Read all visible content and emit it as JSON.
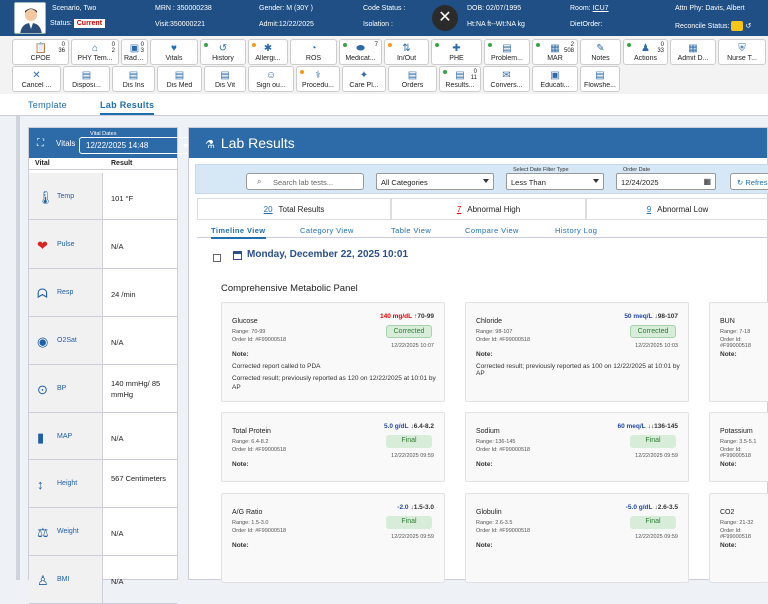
{
  "header": {
    "scenario_label": "Scenario, Two",
    "status_label": "Status:",
    "status_value": "Current",
    "mrn": "MRN : 350000238",
    "visit": "Visit:350000221",
    "gender": "Gender: M (30Y )",
    "admit": "Admit:12/22/2025",
    "code_status": "Code Status :",
    "isolation": "Isolation :",
    "dob": "DOB: 02/07/1995",
    "ht_wt": "Ht:NA ft--Wt:NA kg",
    "room_label": "Room:",
    "room_value": "ICU7",
    "diet": "DietOrder:",
    "attn": "Attn Phy: Davis, Albert",
    "reconcile": "Reconcile Status:"
  },
  "toolbar": [
    {
      "label": "CPOE",
      "icon": "clipboard-icon",
      "dot": "",
      "cnt": "0\n36"
    },
    {
      "label": "PHY Tem...",
      "icon": "home-icon",
      "dot": "",
      "cnt": "0\n2"
    },
    {
      "label": "Radiolo...",
      "icon": "radiology-icon",
      "dot": "",
      "cnt": "0\n3"
    },
    {
      "label": "Vitals",
      "icon": "heart-icon",
      "dot": "",
      "cnt": ""
    },
    {
      "label": "History",
      "icon": "history-icon",
      "dot": "g",
      "cnt": ""
    },
    {
      "label": "Allergi...",
      "icon": "allergy-icon",
      "dot": "o",
      "cnt": ""
    },
    {
      "label": "ROS",
      "icon": "ros-icon",
      "dot": "",
      "cnt": ""
    },
    {
      "label": "Medicat...",
      "icon": "pill-icon",
      "dot": "g",
      "cnt": "7"
    },
    {
      "label": "In/Out",
      "icon": "inout-icon",
      "dot": "o",
      "cnt": ""
    },
    {
      "label": "PHE",
      "icon": "phe-icon",
      "dot": "g",
      "cnt": ""
    },
    {
      "label": "Problem...",
      "icon": "problem-icon",
      "dot": "g",
      "cnt": ""
    },
    {
      "label": "MAR",
      "icon": "mar-icon",
      "dot": "g",
      "cnt": "2\n508"
    },
    {
      "label": "Notes",
      "icon": "notes-icon",
      "dot": "",
      "cnt": ""
    },
    {
      "label": "Actions",
      "icon": "actions-icon",
      "dot": "g",
      "cnt": "0\n33"
    },
    {
      "label": "Admit D...",
      "icon": "admit-icon",
      "dot": "",
      "cnt": ""
    },
    {
      "label": "Nurse T...",
      "icon": "nurse-icon",
      "dot": "",
      "cnt": ""
    },
    {
      "label": "Cancel ...",
      "icon": "cancel-icon",
      "dot": "",
      "cnt": ""
    },
    {
      "label": "Disposi...",
      "icon": "dispo-icon",
      "dot": "",
      "cnt": ""
    },
    {
      "label": "Dis Ins",
      "icon": "disins-icon",
      "dot": "",
      "cnt": ""
    },
    {
      "label": "Dis Med",
      "icon": "dismed-icon",
      "dot": "",
      "cnt": ""
    },
    {
      "label": "Dis Vit",
      "icon": "disvit-icon",
      "dot": "",
      "cnt": ""
    },
    {
      "label": "Sign ou...",
      "icon": "signout-icon",
      "dot": "",
      "cnt": ""
    },
    {
      "label": "Procedu...",
      "icon": "procedure-icon",
      "dot": "o",
      "cnt": ""
    },
    {
      "label": "Care Pl...",
      "icon": "careplan-icon",
      "dot": "",
      "cnt": ""
    },
    {
      "label": "Orders",
      "icon": "orders-icon",
      "dot": "",
      "cnt": ""
    },
    {
      "label": "Results...",
      "icon": "results-icon",
      "dot": "g",
      "cnt": "0\n11"
    },
    {
      "label": "Convers...",
      "icon": "convers-icon",
      "dot": "",
      "cnt": ""
    },
    {
      "label": "Educati...",
      "icon": "education-icon",
      "dot": "",
      "cnt": ""
    },
    {
      "label": "Flowshe...",
      "icon": "flowsheet-icon",
      "dot": "",
      "cnt": ""
    }
  ],
  "subtabs": [
    "Template",
    "Lab Results"
  ],
  "vitals": {
    "title": "Vitals",
    "date_label": "Vital Dates",
    "date_value": "12/22/2025 14:48",
    "col_vital": "Vital",
    "col_result": "Result",
    "rows": [
      {
        "name": "Temp",
        "value": "101 °F",
        "icon": "thermometer-icon"
      },
      {
        "name": "Pulse",
        "value": "N/A",
        "icon": "pulse-icon"
      },
      {
        "name": "Resp",
        "value": "24 /min",
        "icon": "lungs-icon"
      },
      {
        "name": "O2Sat",
        "value": "N/A",
        "icon": "o2sat-icon"
      },
      {
        "name": "BP",
        "value": "140 mmHg/ 85 mmHg",
        "icon": "bp-icon"
      },
      {
        "name": "MAP",
        "value": "N/A",
        "icon": "map-icon"
      },
      {
        "name": "Height",
        "value": "567 Centimeters",
        "icon": "height-icon"
      },
      {
        "name": "Weight",
        "value": "N/A",
        "icon": "weight-icon"
      },
      {
        "name": "BMI",
        "value": "N/A",
        "icon": "bmi-icon"
      }
    ]
  },
  "lab": {
    "title": "Lab Results",
    "search_placeholder": "Search lab tests...",
    "category": "All Categories",
    "date_filter_label": "Select Date Filter Type",
    "date_filter_value": "Less Than",
    "order_date_label": "Order Date",
    "order_date_value": "12/24/2025",
    "refresh": "Refresh",
    "summary": [
      {
        "count": "20",
        "label": "Total Results",
        "color": "#1f6fb0"
      },
      {
        "count": "7",
        "label": "Abnormal High",
        "color": "#d00"
      },
      {
        "count": "9",
        "label": "Abnormal Low",
        "color": "#1f6fb0"
      }
    ],
    "views": [
      "Timeline View",
      "Category View",
      "Table View",
      "Compare View",
      "History Log"
    ],
    "date_header": "Monday, December 22, 2025 10:01",
    "panel_title": "Comprehensive Metabolic Panel",
    "cards": [
      {
        "name": "Glucose",
        "range": "Range: 70-99",
        "order": "Order Id: #F99000518",
        "value": "140 mg/dL",
        "flag": "↑70-99",
        "vcolor": "r",
        "status": "Corrected",
        "stype": "corr",
        "date": "12/22/2025 10:07",
        "note_label": "Note:",
        "note1": "Corrected report called to PDA",
        "note2": "Corrected result; previously reported as 120 on 12/22/2025 at 10:01 by AP"
      },
      {
        "name": "Chloride",
        "range": "Range: 98-107",
        "order": "Order Id: #F99000518",
        "value": "50 meq/L",
        "flag": "↓98-107",
        "vcolor": "b",
        "status": "Corrected",
        "stype": "corr",
        "date": "12/22/2025 10:03",
        "note_label": "Note:",
        "note1": "Corrected result; previously reported as 100 on 12/22/2025 at 10:01 by AP",
        "note2": ""
      },
      {
        "name": "BUN",
        "range": "Range: 7-18",
        "order": "Order Id: #F99000518",
        "value": "",
        "flag": "",
        "vcolor": "b",
        "status": "",
        "stype": "",
        "date": "",
        "note_label": "Note:",
        "note1": "",
        "note2": ""
      },
      {
        "name": "Total Protein",
        "range": "Range: 6.4-8.2",
        "order": "Order Id: #F99000518",
        "value": "5.0 g/dL",
        "flag": "↓6.4-8.2",
        "vcolor": "b",
        "status": "Final",
        "stype": "fin",
        "date": "12/22/2025 09:59",
        "note_label": "Note:",
        "note1": "",
        "note2": ""
      },
      {
        "name": "Sodium",
        "range": "Range: 136-145",
        "order": "Order Id: #F99000518",
        "value": "60 meq/L",
        "flag": "↓↓136-145",
        "vcolor": "b",
        "status": "Final",
        "stype": "fin",
        "date": "12/22/2025 09:59",
        "note_label": "Note:",
        "note1": "",
        "note2": ""
      },
      {
        "name": "Potassium",
        "range": "Range: 3.5-5.1",
        "order": "Order Id: #F99000518",
        "value": "",
        "flag": "",
        "vcolor": "b",
        "status": "",
        "stype": "",
        "date": "",
        "note_label": "Note:",
        "note1": "",
        "note2": ""
      },
      {
        "name": "A/G Ratio",
        "range": "Range: 1.5-3.0",
        "order": "Order Id: #F99000518",
        "value": "-2.0",
        "flag": "↓1.5-3.0",
        "vcolor": "b",
        "status": "Final",
        "stype": "fin",
        "date": "12/22/2025 09:59",
        "note_label": "Note:",
        "note1": "",
        "note2": ""
      },
      {
        "name": "Globulin",
        "range": "Range: 2.6-3.5",
        "order": "Order Id: #F99000518",
        "value": "-5.0 g/dL",
        "flag": "↓2.6-3.5",
        "vcolor": "b",
        "status": "Final",
        "stype": "fin",
        "date": "12/22/2025 09:59",
        "note_label": "Note:",
        "note1": "",
        "note2": ""
      },
      {
        "name": "CO2",
        "range": "Range: 21-32",
        "order": "Order Id: #F99000518",
        "value": "",
        "flag": "",
        "vcolor": "b",
        "status": "",
        "stype": "",
        "date": "",
        "note_label": "Note:",
        "note1": "",
        "note2": ""
      }
    ]
  }
}
